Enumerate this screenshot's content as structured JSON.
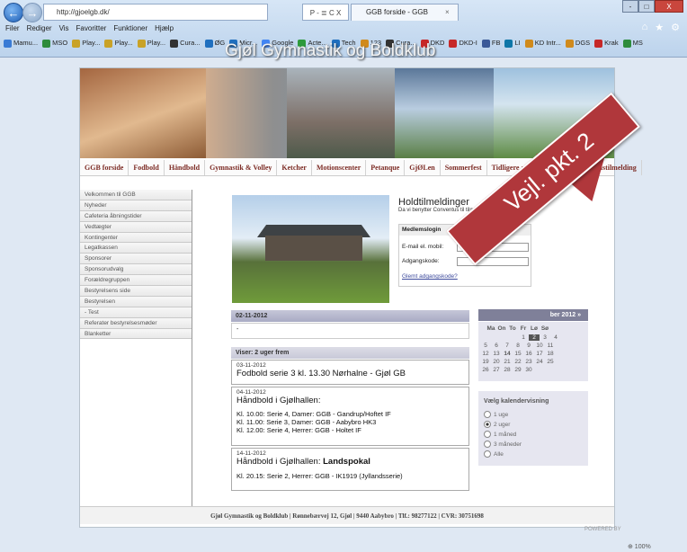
{
  "browser": {
    "address": "http://gjoelgb.dk/",
    "address_controls": "P - ≣ C X",
    "tab_title": "GGB forside - GGB",
    "tab_close": "×",
    "window_controls": [
      "-",
      "□",
      "X"
    ],
    "right_icons": [
      "⌂",
      "★",
      "⚙"
    ],
    "menu": [
      "Filer",
      "Rediger",
      "Vis",
      "Favoritter",
      "Funktioner",
      "Hjælp"
    ],
    "favorites": [
      {
        "label": "Mamu...",
        "color": "#3a7bd5"
      },
      {
        "label": "MSO",
        "color": "#2d8c3c"
      },
      {
        "label": "Play...",
        "color": "#c9a227"
      },
      {
        "label": "Play...",
        "color": "#c9a227"
      },
      {
        "label": "Play...",
        "color": "#c9a227"
      },
      {
        "label": "Cura...",
        "color": "#333333"
      },
      {
        "label": "ØG",
        "color": "#1f6fbf"
      },
      {
        "label": "Micr...",
        "color": "#1f6fbf"
      },
      {
        "label": "Google",
        "color": "#4285f4"
      },
      {
        "label": "Acte...",
        "color": "#2d9a3c"
      },
      {
        "label": "Tech",
        "color": "#1f6fbf"
      },
      {
        "label": "123",
        "color": "#d08a1c"
      },
      {
        "label": "Cura...",
        "color": "#333333"
      },
      {
        "label": "DKD",
        "color": "#c62828"
      },
      {
        "label": "DKD-I",
        "color": "#c62828"
      },
      {
        "label": "FB",
        "color": "#3b5998"
      },
      {
        "label": "LI",
        "color": "#0e76a8"
      },
      {
        "label": "KD Intr...",
        "color": "#d08a1c"
      },
      {
        "label": "DGS",
        "color": "#d08a1c"
      },
      {
        "label": "Krak",
        "color": "#c62828"
      },
      {
        "label": "MS",
        "color": "#2d8c3c"
      }
    ]
  },
  "site": {
    "banner_title": "Gjøl Gymnastik og Boldklub",
    "nav": [
      "GGB forside",
      "Fodbold",
      "Håndbold",
      "Gymnastik & Volley",
      "Ketcher",
      "Motionscenter",
      "Petanque",
      "GjØLen",
      "Sommerfest",
      "Tidligere arrangementer",
      "Medlemstilmelding"
    ],
    "sidebar": [
      "Velkommen til GGB",
      "Nyheder",
      "Cafeteria åbningstider",
      "Vedtægter",
      "Kontingenter",
      "Legatkassen",
      "Sponsorer",
      "Sponsorudvalg",
      "Forældregruppen",
      "Bestyrelsens side",
      "Bestyrelsen",
      "- Test",
      "Referater bestyrelsesmøder",
      "Blanketter"
    ],
    "holdtilmelding": {
      "title": "Holdtilmeldinger",
      "text": "Da vi benytter Conventus til tilmelding til hold kan d... her."
    },
    "login": {
      "header": "Medlemslogin",
      "email_label": "E-mail el. mobil:",
      "password_label": "Adgangskode:",
      "forgot": "Glemt adgangskode?"
    },
    "news": {
      "date": "02-11-2012",
      "body": "-"
    },
    "events_header": "Viser: 2 uger frem",
    "events": [
      {
        "date": "03-11-2012",
        "title": "Fodbold serie 3 kl. 13.30 Nørhalne - Gjøl GB",
        "lines": []
      },
      {
        "date": "04-11-2012",
        "title": "Håndbold i Gjølhallen:",
        "lines": [
          "Kl. 10.00: Serie 4, Damer: GGB - Gandrup/Hoftet IF",
          "Kl. 11.00: Serie 3, Damer: GGB - Aabybro HK3",
          "Kl. 12.00: Serie 4, Herrer: GGB - Holtet IF"
        ]
      },
      {
        "date": "14-11-2012",
        "title": "Håndbold i Gjølhallen: ",
        "title_bold": "Landspokal",
        "lines": [
          "",
          "Kl. 20.15: Serie 2, Herrer: GGB - IK1919 (Jyllandsserie)"
        ]
      }
    ],
    "calendar": {
      "month": "ber 2012",
      "nav": "»",
      "days": [
        "Ma",
        "On",
        "To",
        "Fr",
        "Lø",
        "Sø"
      ],
      "weeks": [
        [
          "",
          "",
          "1",
          "2",
          "3",
          "4"
        ],
        [
          "5",
          "6",
          "7",
          "8",
          "9",
          "10",
          "11"
        ],
        [
          "12",
          "13",
          "14",
          "15",
          "16",
          "17",
          "18"
        ],
        [
          "19",
          "20",
          "21",
          "22",
          "23",
          "24",
          "25"
        ],
        [
          "26",
          "27",
          "28",
          "29",
          "30"
        ]
      ]
    },
    "calendar_view": {
      "title": "Vælg kalendervisning",
      "options": [
        "1 uge",
        "2 uger",
        "1 måned",
        "3 måneder",
        "Alle"
      ],
      "selected_index": 1
    },
    "footer": "Gjøl Gymnastik og Boldklub | Rønnebærvej 12, Gjøl | 9440 Aabybro | Tlf.: 98277122 | CVR: 30751698",
    "powered_by": "POWERED BY",
    "zoom": "⊕ 100%"
  },
  "overlay": {
    "text": "Vejl. pkt. 2",
    "color": "#b0373b"
  }
}
